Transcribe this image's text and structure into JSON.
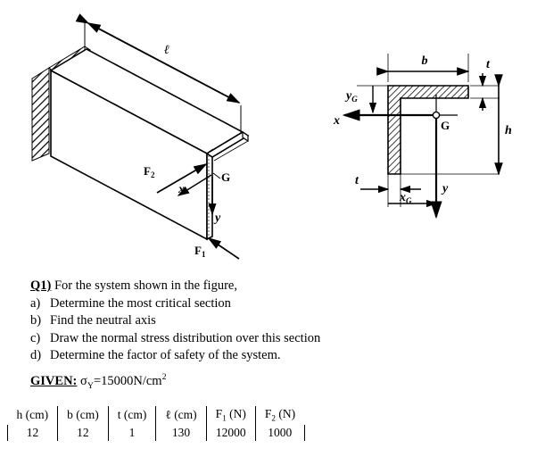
{
  "beam_figure": {
    "title_hint": "3d-cantilever-beam",
    "labels": {
      "length": "ℓ",
      "force2": "F",
      "force2_sub": "2",
      "force1": "F",
      "force1_sub": "1",
      "centroid": "G",
      "axis_x": "x",
      "axis_y": "y"
    }
  },
  "section_figure": {
    "title_hint": "l-shaped-cross-section",
    "labels": {
      "width": "b",
      "height": "h",
      "thickness_top": "t",
      "thickness_left": "t",
      "centroid": "G",
      "axis_x": "x",
      "axis_y": "y",
      "yg": "y",
      "yg_sub": "G",
      "xg": "x",
      "xg_sub": "G"
    }
  },
  "question": {
    "tag": "Q1)",
    "stem": " For the system shown in the figure,",
    "items": [
      {
        "mark": "a)",
        "text": "Determine the most critical section"
      },
      {
        "mark": "b)",
        "text": "Find the neutral axis"
      },
      {
        "mark": "c)",
        "text": "Draw the normal stress distribution over this section"
      },
      {
        "mark": "d)",
        "text": "Determine the factor of safety of the system."
      }
    ]
  },
  "given": {
    "tag": "GIVEN:",
    "symbol": "σ",
    "symbol_sub": "Y",
    "equals": "=",
    "value": "15000",
    "unit": "N/cm",
    "unit_sup": "2"
  },
  "parameters": {
    "headers": [
      {
        "name": "h",
        "unit": "(cm)"
      },
      {
        "name": "b",
        "unit": "(cm)"
      },
      {
        "name": "t",
        "unit": "(cm)"
      },
      {
        "name": "ℓ",
        "unit": "(cm)"
      },
      {
        "name": "F",
        "sub": "1",
        "unit": "(N)"
      },
      {
        "name": "F",
        "sub": "2",
        "unit": "(N)"
      }
    ],
    "values": [
      "12",
      "12",
      "1",
      "130",
      "12000",
      "1000"
    ]
  },
  "colors": {
    "ink": "#000000",
    "paper": "#ffffff"
  }
}
